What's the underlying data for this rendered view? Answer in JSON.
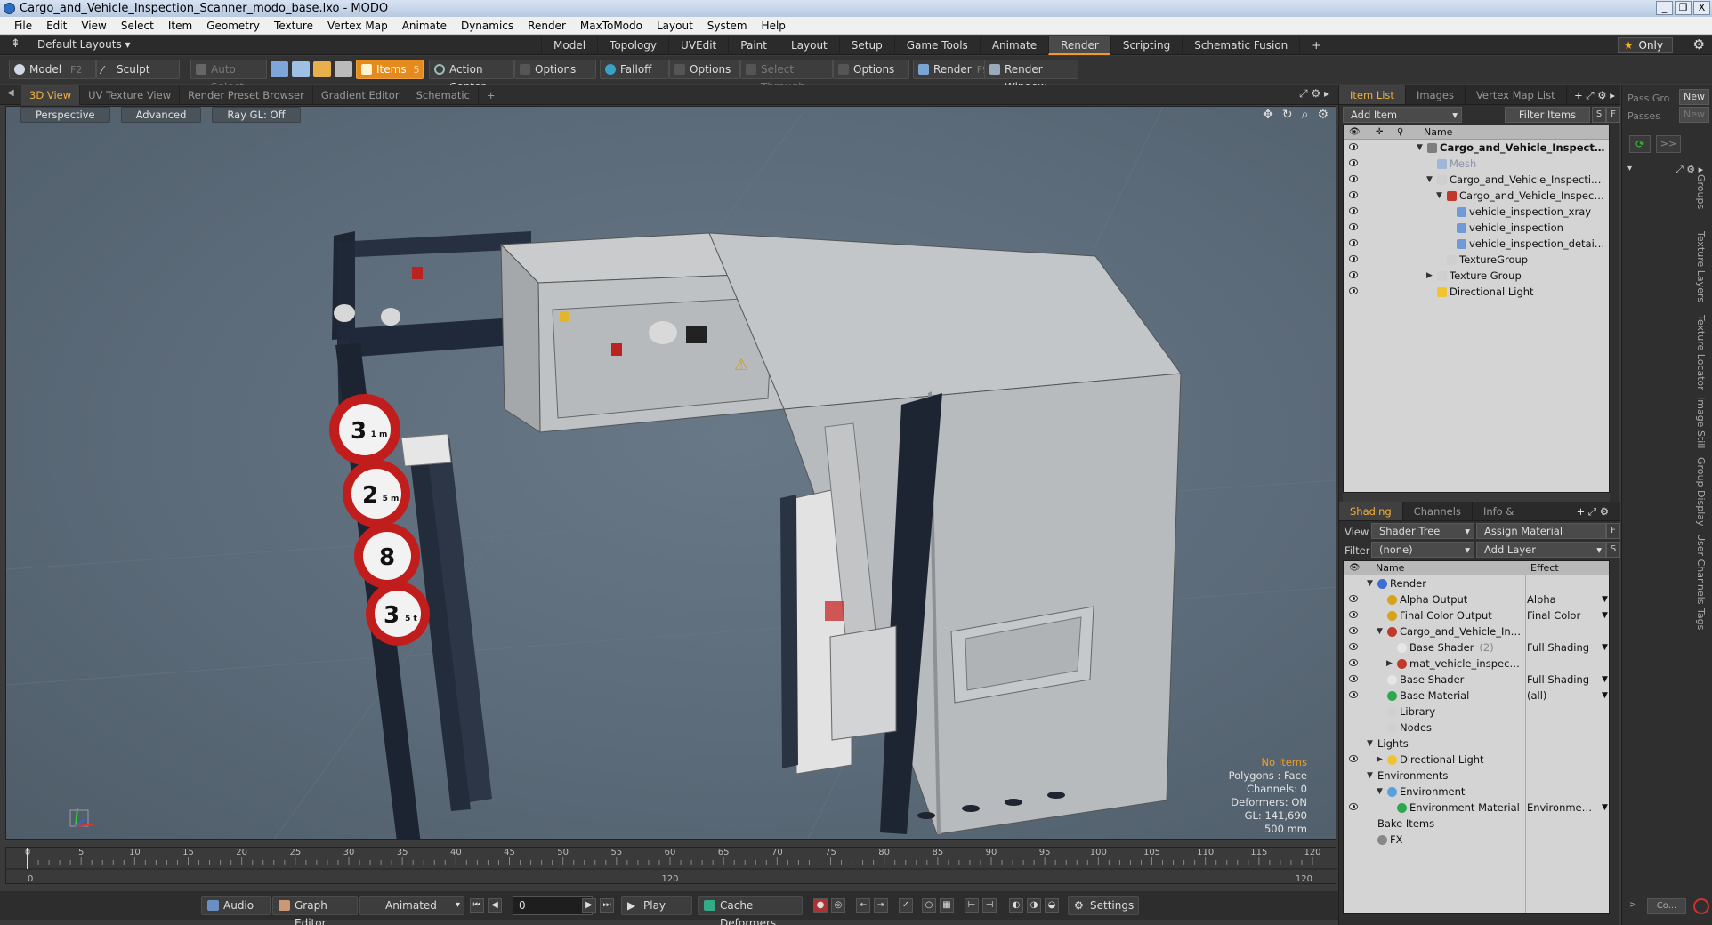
{
  "window": {
    "title": "Cargo_and_Vehicle_Inspection_Scanner_modo_base.lxo - MODO",
    "buttons": [
      "_",
      "❐",
      "X"
    ]
  },
  "menu": [
    "File",
    "Edit",
    "View",
    "Select",
    "Item",
    "Geometry",
    "Texture",
    "Vertex Map",
    "Animate",
    "Dynamics",
    "Render",
    "MaxToModo",
    "Layout",
    "System",
    "Help"
  ],
  "layoutbar": {
    "dropdown": "Default Layouts",
    "tabs": [
      "Model",
      "Topology",
      "UVEdit",
      "Paint",
      "Layout",
      "Setup",
      "Game Tools",
      "Animate",
      "Render",
      "Scripting",
      "Schematic Fusion"
    ],
    "active_tab": "Render",
    "add": "+",
    "only": "Only",
    "star_icon": "star-icon",
    "gear_icon": "gear-icon"
  },
  "toolbar": {
    "model": "Model",
    "model_key": "F2",
    "sculpt": "Sculpt",
    "auto_select": "Auto Select",
    "items": "Items",
    "items_key": "5",
    "action_center": "Action Center",
    "options1": "Options",
    "falloff": "Falloff",
    "options2": "Options",
    "select_through": "Select Through",
    "options3": "Options",
    "render": "Render",
    "render_key": "F9",
    "render_window": "Render Window"
  },
  "viewtabs": [
    "3D View",
    "UV Texture View",
    "Render Preset Browser",
    "Gradient Editor",
    "Schematic"
  ],
  "viewport": {
    "header": [
      "Perspective",
      "Advanced",
      "Ray GL: Off"
    ],
    "stats": {
      "no_items": "No Items",
      "polygons": "Polygons : Face",
      "channels": "Channels: 0",
      "deformers": "Deformers: ON",
      "gl": "GL: 141,690",
      "size": "500 mm"
    },
    "signs": [
      "3",
      "2",
      "8",
      "3"
    ],
    "sign_units": [
      "1 m",
      "5 m",
      "",
      "5 t"
    ],
    "warning_glyph": "⚠"
  },
  "timeline": {
    "ticks": [
      "0",
      "5",
      "10",
      "15",
      "20",
      "25",
      "30",
      "35",
      "40",
      "45",
      "50",
      "55",
      "60",
      "65",
      "70",
      "75",
      "80",
      "85",
      "90",
      "95",
      "100",
      "105",
      "110",
      "115",
      "120"
    ],
    "left_end": "0",
    "mid": "120",
    "right_end": "120"
  },
  "bottom": {
    "audio": "Audio",
    "graph_editor": "Graph Editor",
    "animated": "Animated",
    "frame": "0",
    "play": "Play",
    "cache": "Cache Deformers",
    "settings": "Settings"
  },
  "itemlist": {
    "tabs": [
      "Item List",
      "Images",
      "Vertex Map List"
    ],
    "add_item": "Add Item",
    "filter_items": "Filter Items",
    "s_btn": "S",
    "f_btn": "F",
    "col_name": "Name",
    "rows": [
      {
        "label": "Cargo_and_Vehicle_Inspectio...",
        "indent": 0,
        "icon": "#7d7d7d",
        "tri": "▼",
        "bold": true
      },
      {
        "label": "Mesh",
        "indent": 1,
        "icon": "#9fb6d8",
        "tri": "",
        "dim": true
      },
      {
        "label": "Cargo_and_Vehicle_Inspection_...",
        "indent": 1,
        "icon": "#cfcfcf",
        "tri": "▼"
      },
      {
        "label": "Cargo_and_Vehicle_Inspectio...",
        "indent": 2,
        "icon": "#c0392b",
        "tri": "▼"
      },
      {
        "label": "vehicle_inspection_xray",
        "indent": 3,
        "icon": "#6f9ad6",
        "tri": ""
      },
      {
        "label": "vehicle_inspection",
        "indent": 3,
        "icon": "#6f9ad6",
        "tri": ""
      },
      {
        "label": "vehicle_inspection_detail_b...",
        "indent": 3,
        "icon": "#6f9ad6",
        "tri": ""
      },
      {
        "label": "TextureGroup",
        "indent": 2,
        "icon": "#cfcfcf",
        "tri": ""
      },
      {
        "label": "Texture Group",
        "indent": 1,
        "icon": "#cfcfcf",
        "tri": "▶"
      },
      {
        "label": "Directional Light",
        "indent": 1,
        "icon": "#f0c330",
        "tri": ""
      }
    ]
  },
  "shading": {
    "tabs": [
      "Shading",
      "Channels",
      "Info & Statistics"
    ],
    "view_label": "View",
    "view_value": "Shader Tree",
    "assign_material": "Assign Material",
    "f_btn": "F",
    "filter_label": "Filter",
    "filter_value": "(none)",
    "add_layer": "Add Layer",
    "s_btn": "S",
    "col_name": "Name",
    "col_effect": "Effect",
    "rows": [
      {
        "label": "Render",
        "indent": 0,
        "icon": "#3c6fd1",
        "tri": "▼",
        "effect": "",
        "eye": false
      },
      {
        "label": "Alpha Output",
        "indent": 1,
        "icon": "#d9a21b",
        "tri": "",
        "effect": "Alpha",
        "eye": true
      },
      {
        "label": "Final Color Output",
        "indent": 1,
        "icon": "#d9a21b",
        "tri": "",
        "effect": "Final Color",
        "eye": true
      },
      {
        "label": "Cargo_and_Vehicle_Ins...",
        "indent": 1,
        "icon": "#c0392b",
        "tri": "▼",
        "effect": "",
        "eye": true
      },
      {
        "label": "Base Shader",
        "sub": "(2)",
        "indent": 2,
        "icon": "#e6e6e6",
        "tri": "",
        "effect": "Full Shading",
        "eye": true
      },
      {
        "label": "mat_vehicle_inspecti...",
        "indent": 2,
        "icon": "#c0392b",
        "tri": "▶",
        "effect": "",
        "eye": true
      },
      {
        "label": "Base Shader",
        "indent": 1,
        "icon": "#e6e6e6",
        "tri": "",
        "effect": "Full Shading",
        "eye": true
      },
      {
        "label": "Base Material",
        "indent": 1,
        "icon": "#2ea84f",
        "tri": "",
        "effect": "(all)",
        "eye": true
      },
      {
        "label": "Library",
        "indent": 1,
        "icon": "#cfcfcf",
        "tri": "",
        "effect": "",
        "eye": false
      },
      {
        "label": "Nodes",
        "indent": 1,
        "icon": "#cfcfcf",
        "tri": "",
        "effect": "",
        "eye": false
      },
      {
        "label": "Lights",
        "indent": 0,
        "icon": "",
        "tri": "▼",
        "effect": "",
        "eye": false
      },
      {
        "label": "Directional Light",
        "indent": 1,
        "icon": "#f0c330",
        "tri": "▶",
        "effect": "",
        "eye": true
      },
      {
        "label": "Environments",
        "indent": 0,
        "icon": "",
        "tri": "▼",
        "effect": "",
        "eye": false
      },
      {
        "label": "Environment",
        "indent": 1,
        "icon": "#5aa0e0",
        "tri": "▼",
        "effect": "",
        "eye": false
      },
      {
        "label": "Environment Material",
        "indent": 2,
        "icon": "#2ea84f",
        "tri": "",
        "effect": "Environment C ...",
        "eye": true
      },
      {
        "label": "Bake Items",
        "indent": 0,
        "icon": "",
        "tri": "",
        "effect": "",
        "eye": false
      },
      {
        "label": "FX",
        "indent": 0,
        "icon": "#888",
        "tri": "",
        "effect": "",
        "eye": false
      }
    ]
  },
  "farright": {
    "pass_groups": "Pass Gro",
    "passes": "Passes",
    "new1": "New",
    "new2": "New",
    "arrow": ">>",
    "vtabs": [
      "Groups",
      "Texture Layers",
      "Texture Locator",
      "Image Still",
      "Group Display",
      "User Channels",
      "Tags"
    ],
    "co": "Co..."
  }
}
